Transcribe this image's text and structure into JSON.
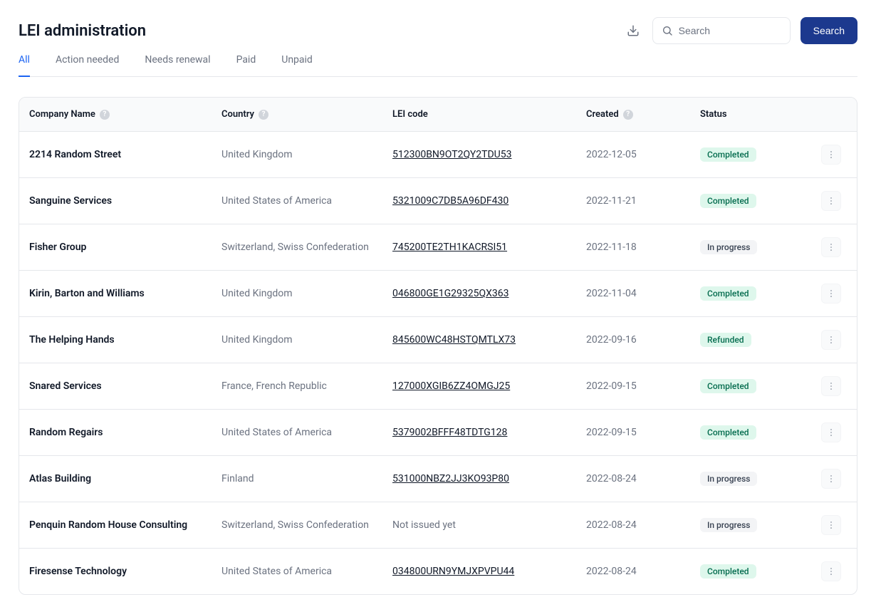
{
  "header": {
    "title": "LEI administration",
    "search_placeholder": "Search",
    "search_button": "Search"
  },
  "tabs": [
    {
      "label": "All",
      "active": true
    },
    {
      "label": "Action needed",
      "active": false
    },
    {
      "label": "Needs renewal",
      "active": false
    },
    {
      "label": "Paid",
      "active": false
    },
    {
      "label": "Unpaid",
      "active": false
    }
  ],
  "columns": {
    "company": "Company Name",
    "country": "Country",
    "lei": "LEI code",
    "created": "Created",
    "status": "Status"
  },
  "status_labels": {
    "completed": "Completed",
    "inprogress": "In progress",
    "refunded": "Refunded"
  },
  "not_issued_label": "Not issued yet",
  "rows": [
    {
      "company": "2214 Random Street",
      "country": "United Kingdom",
      "lei": "512300BN9OT2QY2TDU53",
      "created": "2022-12-05",
      "status": "completed"
    },
    {
      "company": "Sanguine Services",
      "country": "United States of America",
      "lei": "5321009C7DB5A96DF430",
      "created": "2022-11-21",
      "status": "completed"
    },
    {
      "company": "Fisher Group",
      "country": "Switzerland, Swiss Confederation",
      "lei": "745200TE2TH1KACRSI51",
      "created": "2022-11-18",
      "status": "inprogress"
    },
    {
      "company": "Kirin, Barton and Williams",
      "country": "United Kingdom",
      "lei": "046800GE1G29325QX363",
      "created": "2022-11-04",
      "status": "completed"
    },
    {
      "company": "The Helping Hands",
      "country": "United Kingdom",
      "lei": "845600WC48HSTQMTLX73",
      "created": "2022-09-16",
      "status": "refunded"
    },
    {
      "company": "Snared Services",
      "country": "France, French Republic",
      "lei": "127000XGIB6ZZ4OMGJ25",
      "created": "2022-09-15",
      "status": "completed"
    },
    {
      "company": "Random Regairs",
      "country": "United States of America",
      "lei": "5379002BFFF48TDTG128",
      "created": "2022-09-15",
      "status": "completed"
    },
    {
      "company": "Atlas Building",
      "country": "Finland",
      "lei": "531000NBZ2JJ3KO93P80",
      "created": "2022-08-24",
      "status": "inprogress"
    },
    {
      "company": "Penquin Random House Consulting",
      "country": "Switzerland, Swiss Confederation",
      "lei": "",
      "created": "2022-08-24",
      "status": "inprogress"
    },
    {
      "company": "Firesense Technology",
      "country": "United States of America",
      "lei": "034800URN9YMJXPVPU44",
      "created": "2022-08-24",
      "status": "completed"
    }
  ]
}
